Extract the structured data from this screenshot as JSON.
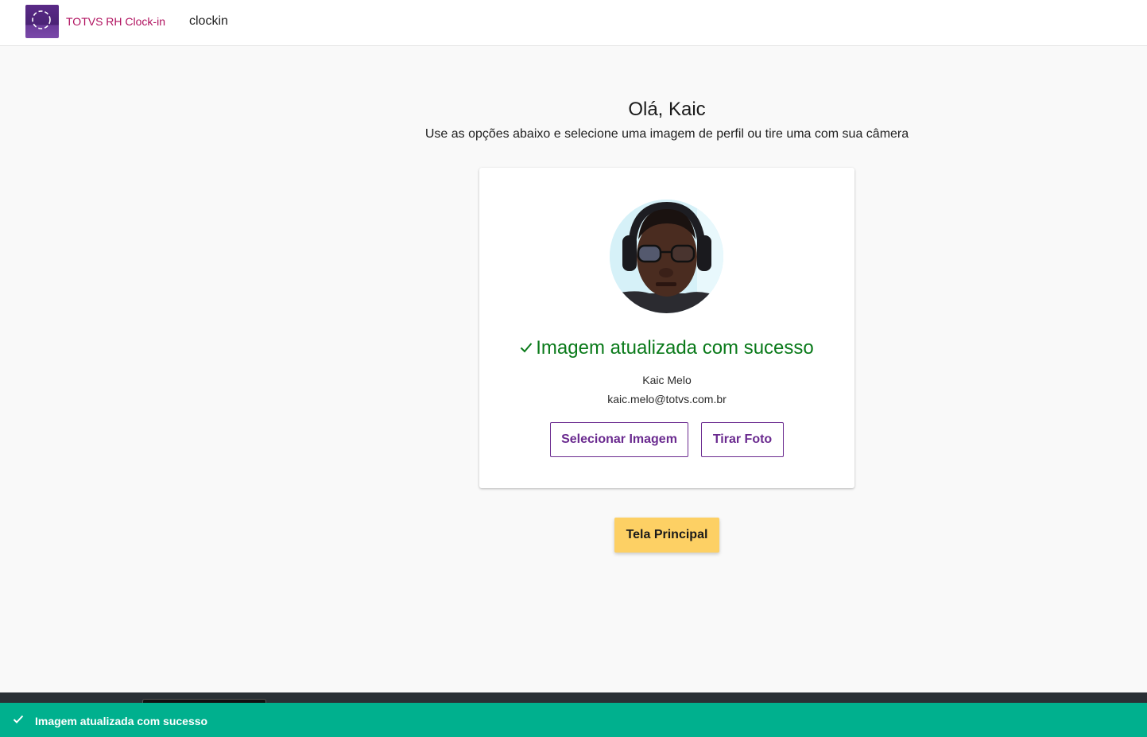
{
  "header": {
    "app_name": "TOTVS RH Clock-in",
    "user_label": "clockin",
    "logo_icon": "dashed-circle-logo-icon"
  },
  "main": {
    "greeting": "Olá, Kaic",
    "subtitle": "Use as opções abaixo e selecione uma imagem de perfil ou tire uma com sua câmera"
  },
  "card": {
    "avatar_icon": "profile-photo",
    "success_message": "Imagem atualizada com sucesso",
    "name": "Kaic Melo",
    "email": "kaic.melo@totvs.com.br",
    "select_image_label": "Selecionar Imagem",
    "take_photo_label": "Tirar Foto"
  },
  "actions": {
    "main_screen_label": "Tela Principal"
  },
  "toast": {
    "message": "Imagem atualizada com sucesso",
    "icon": "check-icon"
  },
  "colors": {
    "brand_purple": "#6a2a8f",
    "app_name_color": "#b0105e",
    "success_green": "#0a7a1a",
    "primary_yellow": "#fdd064",
    "toast_green": "#00b08e"
  }
}
